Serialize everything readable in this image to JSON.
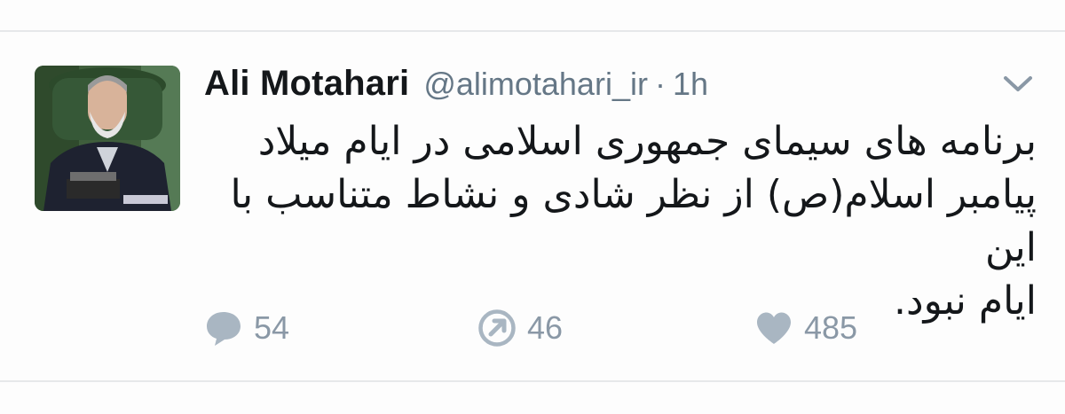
{
  "tweet": {
    "display_name": "Ali Motahari",
    "handle": "@alimotahari_ir",
    "separator": "·",
    "time": "1h",
    "text_lines": [
      "برنامه های سیمای جمهوری اسلامی در ایام میلاد",
      "پیامبر اسلام(ص) از نظر شادی و نشاط متناسب با این",
      "ایام نبود."
    ]
  },
  "actions": {
    "reply": {
      "icon": "speech-bubble-icon",
      "count": "54"
    },
    "retweet": {
      "icon": "arrow-circle-icon",
      "count": "46"
    },
    "like": {
      "icon": "heart-icon",
      "count": "485"
    }
  },
  "colors": {
    "text": "#14171a",
    "secondary": "#657786",
    "action_icons": "#a9b6c2",
    "divider": "#e6e8ea"
  }
}
